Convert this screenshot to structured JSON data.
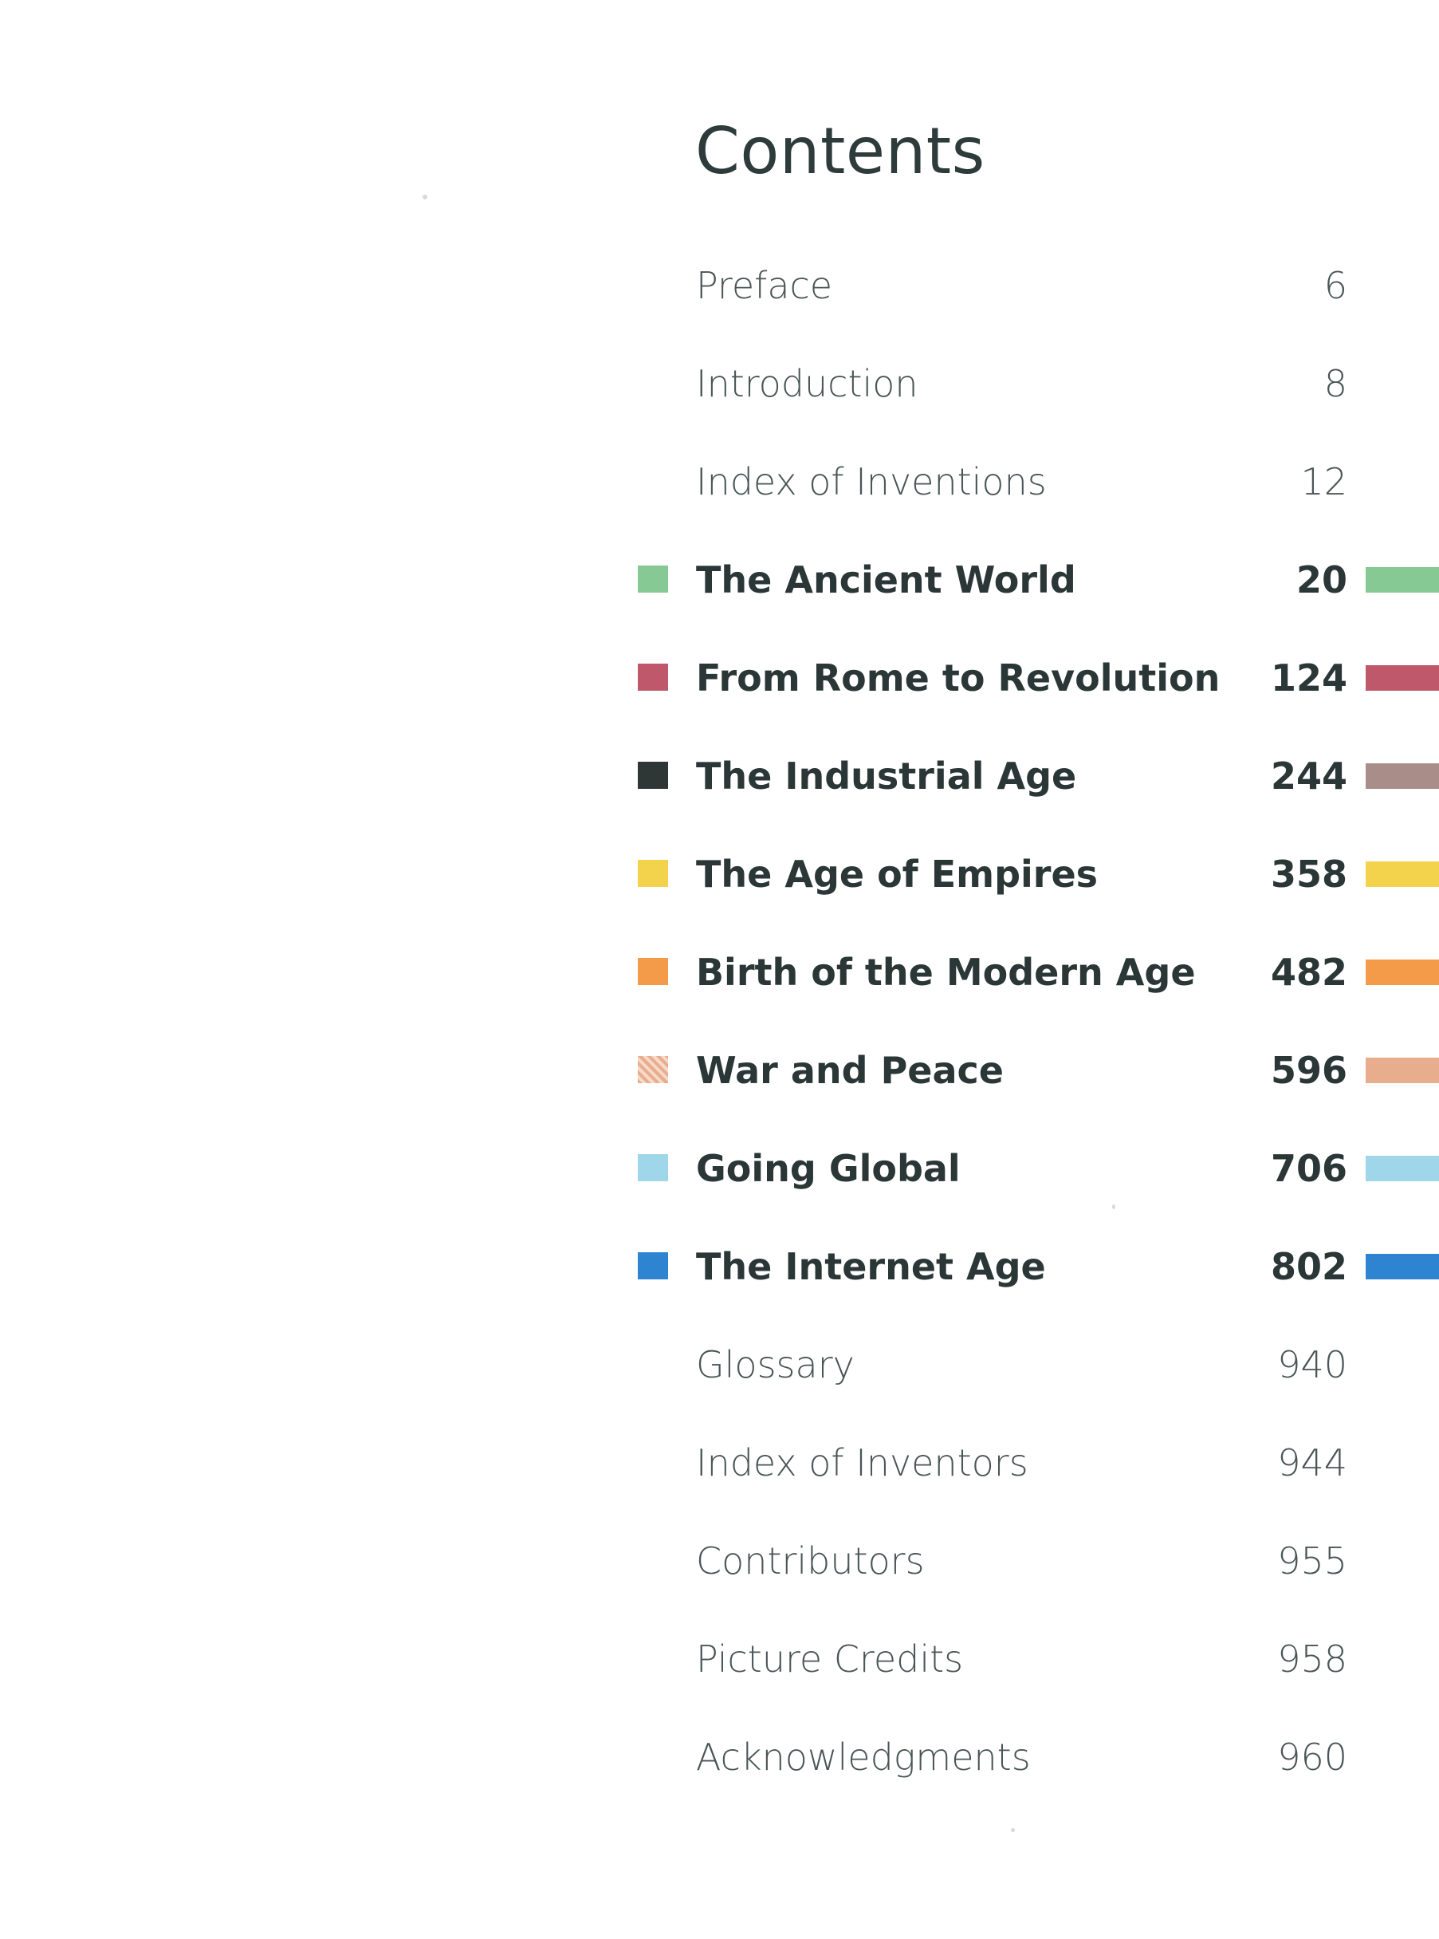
{
  "heading": "Contents",
  "colors": {
    "ancient_world": "#86c995",
    "rome_revolution": "#c0586b",
    "industrial_age": "#2f3636",
    "industrial_tab": "#a98d88",
    "age_of_empires": "#f3d34c",
    "modern_age": "#f49b4a",
    "war_and_peace": "#e8ad8c",
    "going_global": "#9fd6ea",
    "internet_age": "#2f84d2"
  },
  "entries": [
    {
      "label": "Preface",
      "page": "6"
    },
    {
      "label": "Introduction",
      "page": "8"
    },
    {
      "label": "Index of Inventions",
      "page": "12"
    },
    {
      "label": "The Ancient World",
      "page": "20"
    },
    {
      "label": "From Rome to Revolution",
      "page": "124"
    },
    {
      "label": "The Industrial Age",
      "page": "244"
    },
    {
      "label": "The Age of Empires",
      "page": "358"
    },
    {
      "label": "Birth of the Modern Age",
      "page": "482"
    },
    {
      "label": "War and Peace",
      "page": "596"
    },
    {
      "label": "Going Global",
      "page": "706"
    },
    {
      "label": "The Internet Age",
      "page": "802"
    },
    {
      "label": "Glossary",
      "page": "940"
    },
    {
      "label": "Index of Inventors",
      "page": "944"
    },
    {
      "label": "Contributors",
      "page": "955"
    },
    {
      "label": "Picture Credits",
      "page": "958"
    },
    {
      "label": "Acknowledgments",
      "page": "960"
    }
  ]
}
